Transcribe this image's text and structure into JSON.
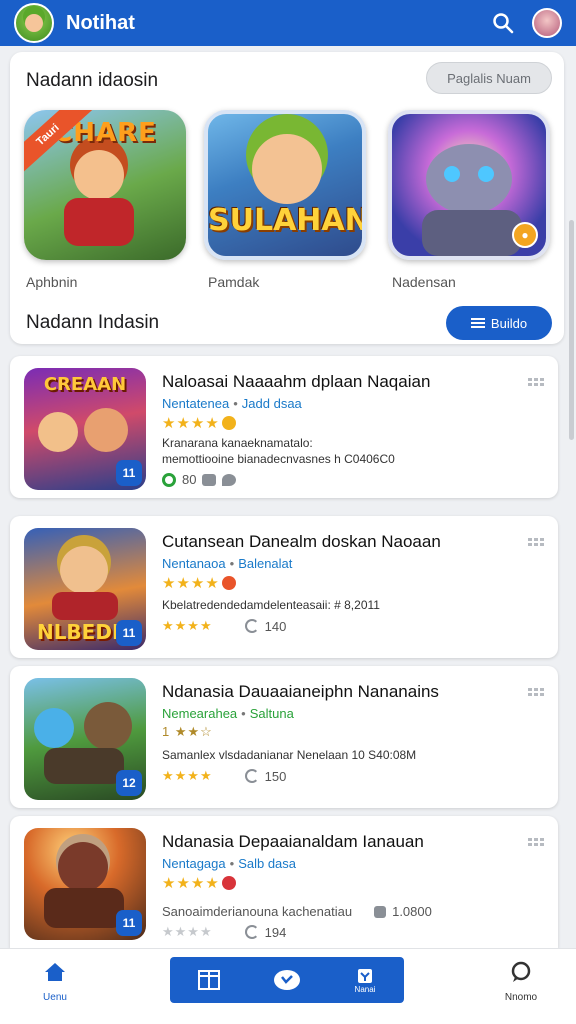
{
  "app": {
    "title": "Notihat"
  },
  "featured": {
    "heading": "Nadann idaosin",
    "pill_label": "Paglalis Nuam",
    "tiles": [
      {
        "word": "CHARE",
        "ribbon": "Tauri",
        "caption": "Aphbnin"
      },
      {
        "word": "SULAHAN",
        "caption": "Pamdak"
      },
      {
        "word": "",
        "caption": "Nadensan"
      }
    ],
    "subheading": "Nadann Indasin",
    "action_label": "Buildo"
  },
  "items": [
    {
      "thumb_word": "CREAAN",
      "badge": "11",
      "title": "Naloasai Naaaahm dplaan Naqaian",
      "meta_a": "Nentatenea",
      "meta_b": "Jadd dsaa",
      "stars": "★★★★",
      "desc_1": "Kranarana kanaeknamatalo:",
      "desc_2": "memottiooine bianadecnvasnes h  C0406C0",
      "foot": "80"
    },
    {
      "thumb_word": "NLBEDIE",
      "badge": "11",
      "title": "Cutansean Danealm doskan Naoaan",
      "meta_a": "Nentanaoa",
      "meta_b": "Balenalat",
      "stars": "★★★★",
      "desc_1": "Kbelatredendedamdelenteasaii: # 8,2011",
      "rating_row": "★★★★",
      "rating_count": "140"
    },
    {
      "thumb_word": "",
      "badge": "12",
      "title": "Ndanasia Dauaaianeiphn Nananains",
      "meta_a": "Nemearahea",
      "meta_b": "Saltuna",
      "stars_text": "1 ★★☆",
      "desc_1": "Samanlex vlsdadanianar Nenelaan  10 S40:08M",
      "rating_row": "★★★★",
      "rating_count": "150"
    },
    {
      "thumb_word": "",
      "badge": "11",
      "title": "Ndanasia Depaaianaldam Ianauan",
      "meta_a": "Nentagaga",
      "meta_b": "Salb dasa",
      "stars": "★★★★",
      "desc_1": "Sanoaimderianouna kachenatiau",
      "desc_extra": "1.0800",
      "rating_row": "★★★★",
      "rating_count": "194"
    }
  ],
  "nav": {
    "home_label": "Uenu",
    "center_right_label": "Nanai",
    "profile_label": "Nnomo"
  },
  "colors": {
    "primary": "#1a5fc9",
    "star": "#f2b21b",
    "green": "#2aa23a"
  }
}
